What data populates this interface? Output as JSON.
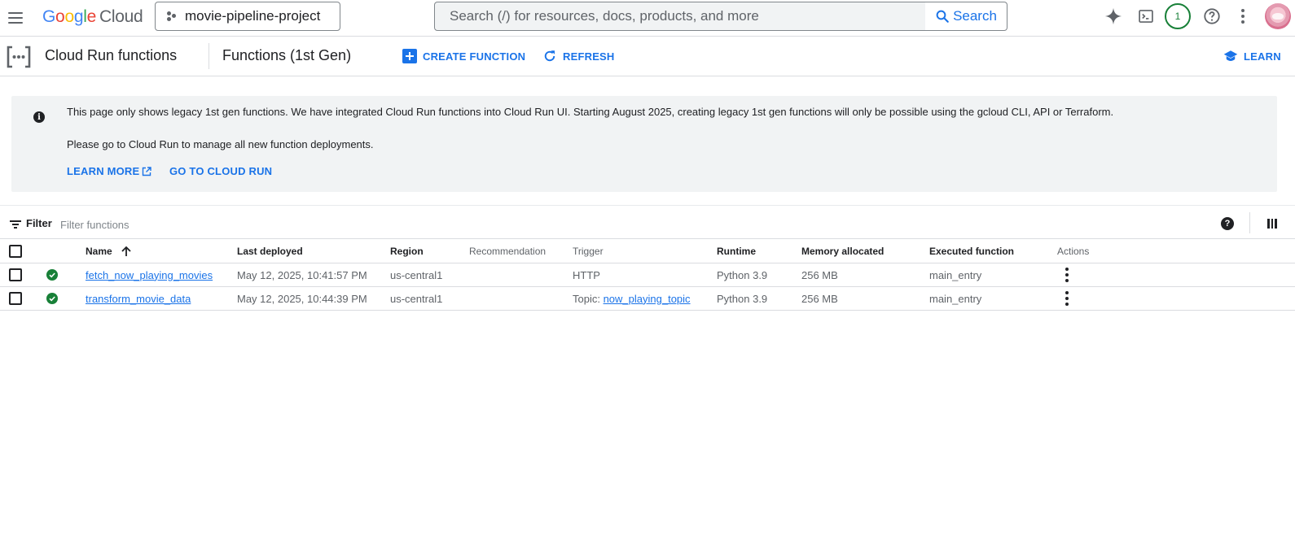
{
  "topbar": {
    "logo_google_letters": [
      "G",
      "o",
      "o",
      "g",
      "l",
      "e"
    ],
    "logo_cloud": "Cloud",
    "project": "movie-pipeline-project",
    "search_placeholder": "Search (/) for resources, docs, products, and more",
    "search_button": "Search",
    "notification_count": "1",
    "icons": [
      "menu-icon",
      "gemini-spark-icon",
      "cloud-shell-icon",
      "help-icon",
      "more-vert-icon",
      "avatar"
    ]
  },
  "header": {
    "product": "Cloud Run functions",
    "title": "Functions (1st Gen)",
    "create_function": "CREATE FUNCTION",
    "refresh": "REFRESH",
    "learn": "LEARN"
  },
  "banner": {
    "line1": "This page only shows legacy 1st gen functions. We have integrated Cloud Run functions into Cloud Run UI. Starting August 2025, creating legacy 1st gen functions will only be possible using the gcloud CLI, API or Terraform.",
    "line2": "Please go to Cloud Run to manage all new function deployments.",
    "learn_more": "LEARN MORE",
    "go_to_cloud_run": "GO TO CLOUD RUN"
  },
  "filter": {
    "label": "Filter",
    "placeholder": "Filter functions"
  },
  "table": {
    "columns": {
      "name": "Name",
      "last_deployed": "Last deployed",
      "region": "Region",
      "recommendation": "Recommendation",
      "trigger": "Trigger",
      "runtime": "Runtime",
      "memory": "Memory allocated",
      "executed_function": "Executed function",
      "actions": "Actions"
    },
    "sort": "name ascending",
    "rows": [
      {
        "status": "ok",
        "name": "fetch_now_playing_movies",
        "last_deployed": "May 12, 2025, 10:41:57 PM",
        "region": "us-central1",
        "recommendation": "",
        "trigger_prefix": "HTTP",
        "trigger_link": "",
        "runtime": "Python 3.9",
        "memory": "256 MB",
        "executed_function": "main_entry"
      },
      {
        "status": "ok",
        "name": "transform_movie_data",
        "last_deployed": "May 12, 2025, 10:44:39 PM",
        "region": "us-central1",
        "recommendation": "",
        "trigger_prefix": "Topic: ",
        "trigger_link": "now_playing_topic",
        "runtime": "Python 3.9",
        "memory": "256 MB",
        "executed_function": "main_entry"
      }
    ]
  },
  "colors": {
    "accent": "#1a73e8",
    "success": "#188038",
    "banner_bg": "#f1f3f4",
    "divider": "#dadce0"
  }
}
